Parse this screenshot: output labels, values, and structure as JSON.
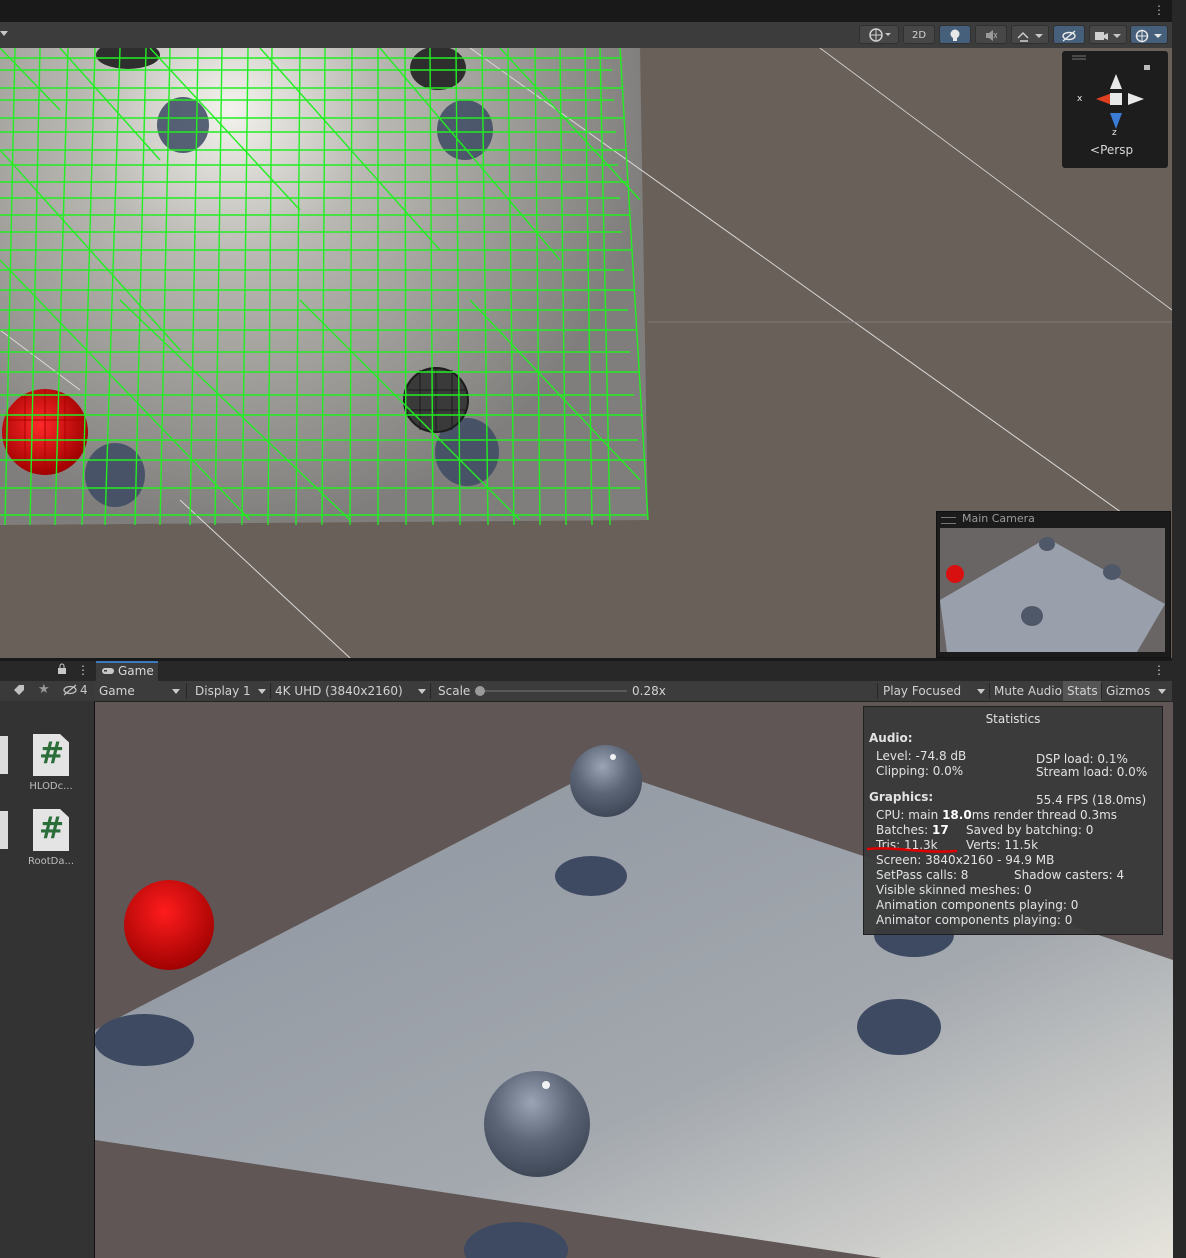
{
  "scene": {
    "toolbar": {
      "mode_2d": "2D"
    },
    "gizmo": {
      "axis_x": "x",
      "axis_z": "z",
      "projection": "Persp"
    },
    "camera_preview": {
      "title": "Main Camera"
    }
  },
  "project_panel": {
    "hidden_count": "4",
    "files": [
      {
        "name": "HLODc..."
      },
      {
        "name": "RootDa..."
      }
    ],
    "file_glyph": "#"
  },
  "game": {
    "tab_label": "Game",
    "view_select": "Game",
    "display": "Display 1",
    "resolution": "4K UHD (3840x2160)",
    "scale_label": "Scale",
    "scale_value": "0.28x",
    "play_focused": "Play Focused",
    "mute_audio": "Mute Audio",
    "stats": "Stats",
    "gizmos": "Gizmos"
  },
  "statistics": {
    "title": "Statistics",
    "audio_heading": "Audio:",
    "level": "Level: -74.8 dB",
    "clipping": "Clipping: 0.0%",
    "dsp_load": "DSP load: 0.1%",
    "stream_load": "Stream load: 0.0%",
    "graphics_heading": "Graphics:",
    "fps": "55.4 FPS (18.0ms)",
    "cpu_prefix": "CPU: main",
    "cpu_main": "18.0",
    "cpu_suffix": "ms  render thread 0.3ms",
    "batches_prefix": "Batches:",
    "batches": "17",
    "saved_batching": "Saved by batching: 0",
    "tris": "Tris: 11.3k",
    "verts": "Verts: 11.5k",
    "screen": "Screen: 3840x2160 - 94.9 MB",
    "setpass": "SetPass calls: 8",
    "shadow_casters": "Shadow casters: 4",
    "skinned_meshes": "Visible skinned meshes: 0",
    "animation_components": "Animation components playing: 0",
    "animator_components": "Animator components playing: 0"
  },
  "annotation_color": "#e00000",
  "accent_color": "#3a79bb"
}
